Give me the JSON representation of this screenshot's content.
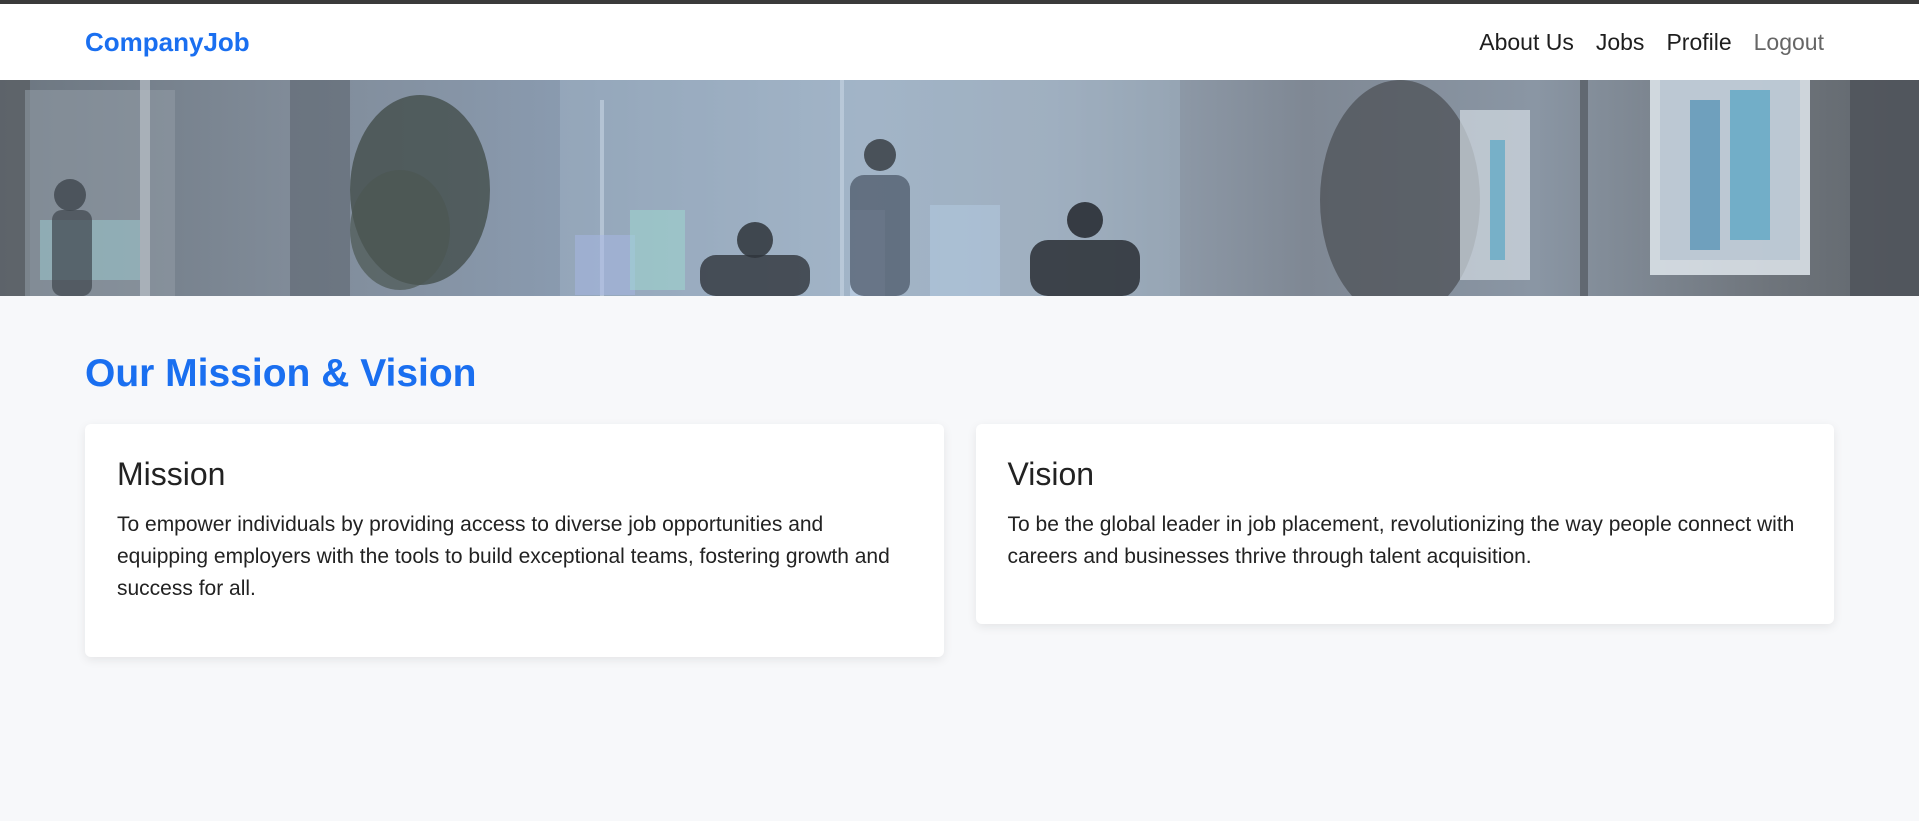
{
  "navbar": {
    "brand": "CompanyJob",
    "links": [
      {
        "label": "About Us"
      },
      {
        "label": "Jobs"
      },
      {
        "label": "Profile"
      },
      {
        "label": "Logout"
      }
    ]
  },
  "section": {
    "title": "Our Mission & Vision"
  },
  "cards": {
    "mission": {
      "title": "Mission",
      "text": "To empower individuals by providing access to diverse job opportunities and equipping employers with the tools to build exceptional teams, fostering growth and success for all."
    },
    "vision": {
      "title": "Vision",
      "text": "To be the global leader in job placement, revolutionizing the way people connect with careers and businesses thrive through talent acquisition."
    }
  },
  "colors": {
    "accent": "#1a6ff0",
    "background": "#f7f8fa"
  }
}
